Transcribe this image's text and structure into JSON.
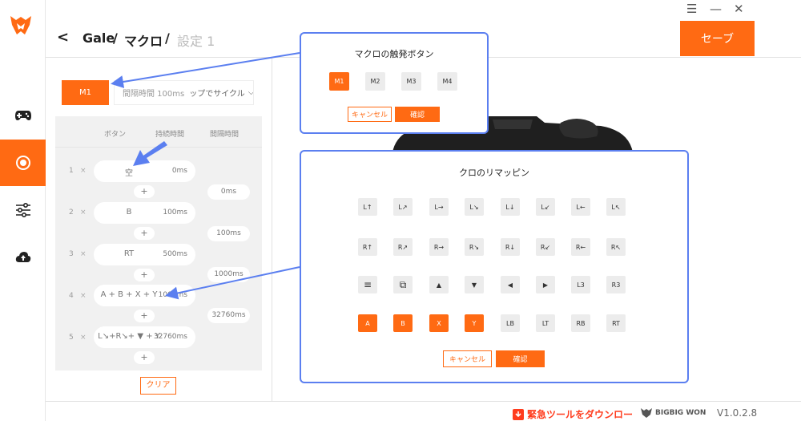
{
  "window": {
    "menu_icon": "hamburger-icon",
    "minimize_icon": "minimize-icon",
    "close_icon": "close-icon"
  },
  "sidebar": {
    "items": [
      {
        "icon": "gamepad-icon"
      },
      {
        "icon": "macro-target-icon",
        "active": true
      },
      {
        "icon": "sliders-icon"
      },
      {
        "icon": "cloud-upload-icon"
      }
    ]
  },
  "header": {
    "crumb1": "Gale",
    "sep1": "/",
    "crumb2": "マクロ",
    "sep2": "/",
    "crumb3": "設定 1",
    "save_label": "セーブ"
  },
  "macro": {
    "selected_key": "M1",
    "interval_text": "間隔時間 100ms",
    "cycle_mode": "ップでサイクル",
    "col_button": "ボタン",
    "col_duration": "持続時間",
    "col_interval": "間隔時間",
    "steps": [
      {
        "num": "1",
        "x": "×",
        "key": "空",
        "duration": "0ms"
      },
      {
        "num": "2",
        "x": "×",
        "key": "B",
        "duration": "100ms"
      },
      {
        "num": "3",
        "x": "×",
        "key": "RT",
        "duration": "500ms"
      },
      {
        "num": "4",
        "x": "×",
        "key": "A + B + X + Y",
        "duration": "1000ms"
      },
      {
        "num": "5",
        "x": "×",
        "key": "L↘+R↘+ ▼ + Y",
        "duration": "32760ms"
      }
    ],
    "intervals": [
      "0ms",
      "100ms",
      "1000ms",
      "32760ms"
    ],
    "plus": "+",
    "clear_label": "クリア"
  },
  "trigger_popup": {
    "title": "マクロの触発ボタン",
    "keys": [
      "M1",
      "M2",
      "M3",
      "M4"
    ],
    "selected": "M1",
    "cancel": "キャンセル",
    "ok": "確認"
  },
  "remap_popup": {
    "title": "クロのリマッピン",
    "rows": [
      [
        "L↑",
        "L↗",
        "L→",
        "L↘",
        "L↓",
        "L↙",
        "L←",
        "L↖"
      ],
      [
        "R↑",
        "R↗",
        "R→",
        "R↘",
        "R↓",
        "R↙",
        "R←",
        "R↖"
      ],
      [
        "≡",
        "⧉",
        "▲",
        "▼",
        "◀",
        "▶",
        "L3",
        "R3"
      ],
      [
        "A",
        "B",
        "X",
        "Y",
        "LB",
        "LT",
        "RB",
        "RT"
      ]
    ],
    "selected": [
      "A",
      "B",
      "X",
      "Y"
    ],
    "cancel": "キャンセル",
    "ok": "確認"
  },
  "footer": {
    "download_text": "緊急ツールをダウンロー",
    "brand": "BIGBIG WON",
    "version": "V1.0.2.8"
  },
  "colors": {
    "accent": "#ff6a13",
    "popup_border": "#5b7ff0",
    "arrow": "#5b7ff0"
  }
}
